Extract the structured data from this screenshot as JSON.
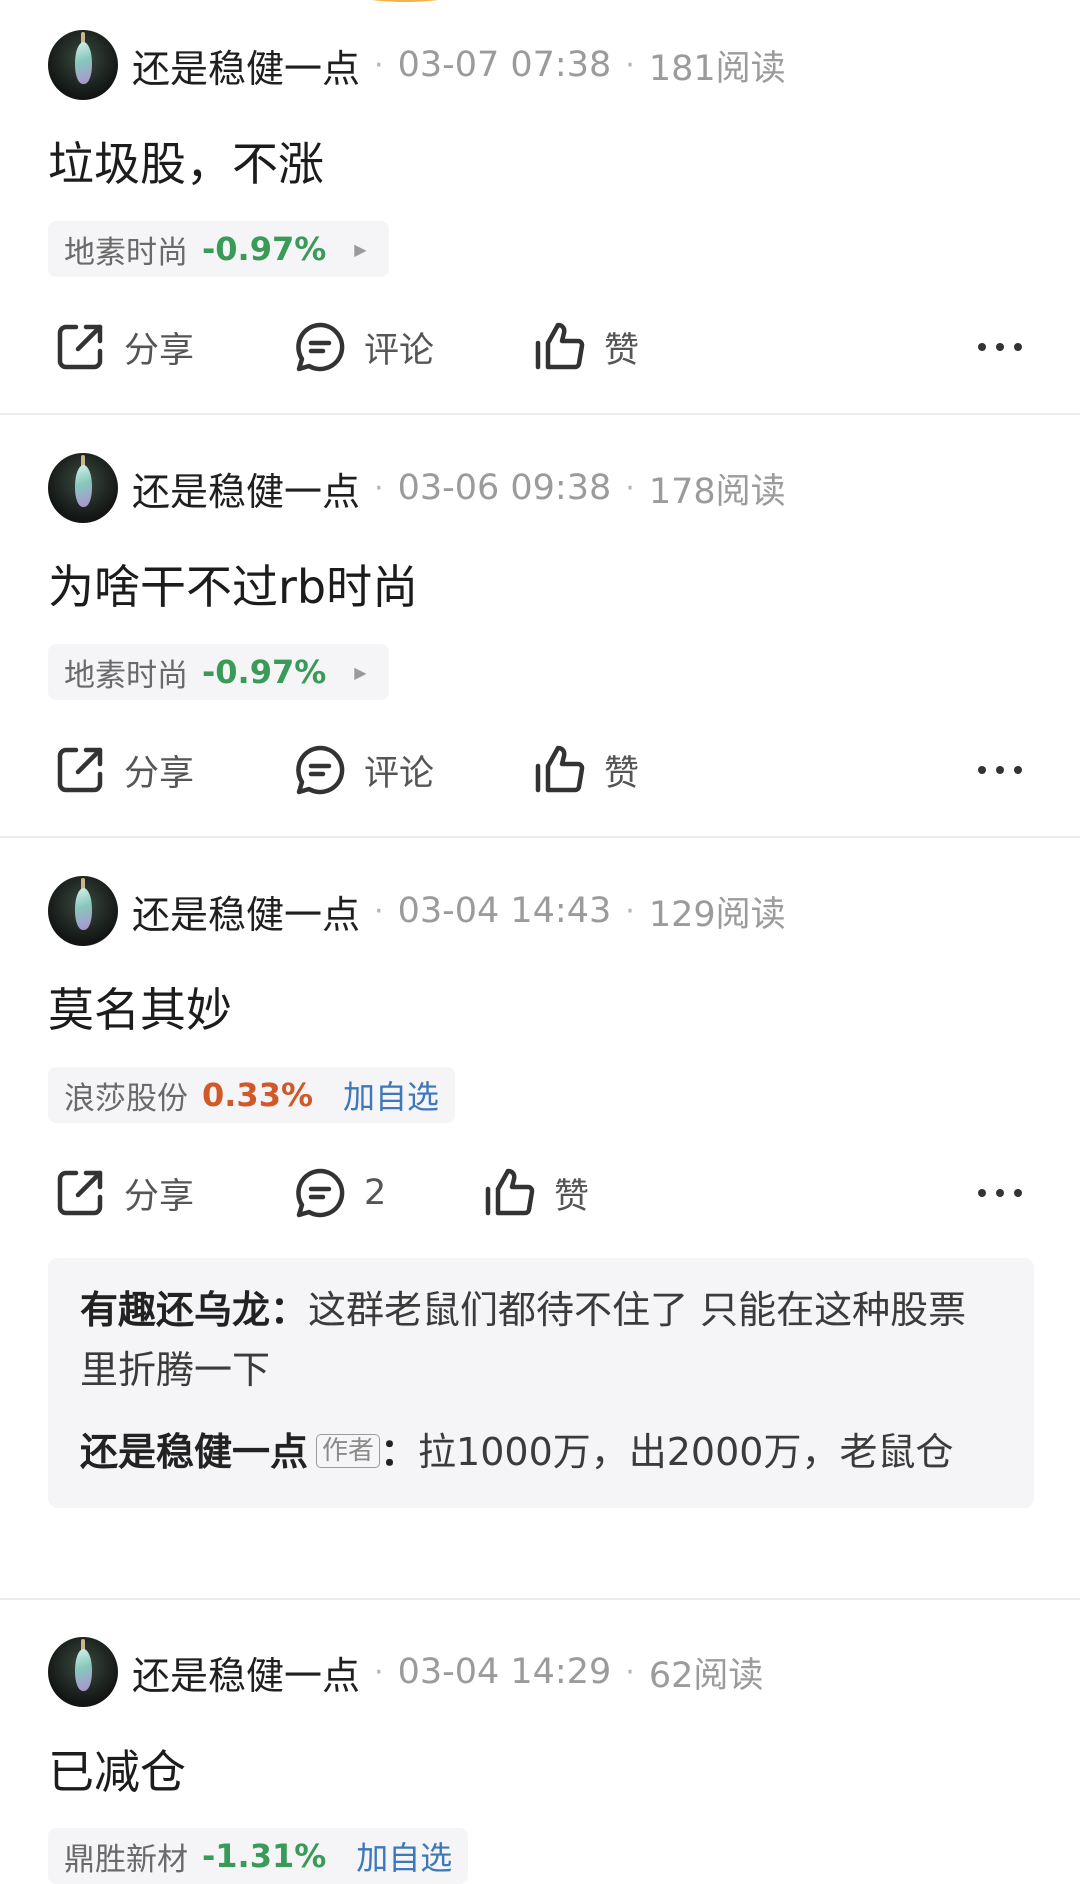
{
  "colors": {
    "down": "#3a9a57",
    "up": "#d0592a",
    "add_link": "#3d78b8"
  },
  "actions": {
    "share": "分享",
    "comment": "评论",
    "like": "赞"
  },
  "posts": [
    {
      "username": "还是稳健一点",
      "time": "03-07 07:38",
      "reads": "181阅读",
      "content": "垃圾股，不涨",
      "stock": {
        "name": "地素时尚",
        "change": "-0.97%",
        "direction": "down"
      }
    },
    {
      "username": "还是稳健一点",
      "time": "03-06 09:38",
      "reads": "178阅读",
      "content": "为啥干不过rb时尚",
      "stock": {
        "name": "地素时尚",
        "change": "-0.97%",
        "direction": "down"
      }
    },
    {
      "username": "还是稳健一点",
      "time": "03-04 14:43",
      "reads": "129阅读",
      "content": "莫名其妙",
      "stock": {
        "name": "浪莎股份",
        "change": "0.33%",
        "direction": "up",
        "add_label": "加自选"
      },
      "comment_count": "2",
      "comments": [
        {
          "author": "有趣还乌龙",
          "text": "这群老鼠们都待不住了 只能在这种股票里折腾一下"
        },
        {
          "author": "还是稳健一点",
          "badge": "作者",
          "text": "拉1000万，出2000万，老鼠仓"
        }
      ]
    },
    {
      "username": "还是稳健一点",
      "time": "03-04 14:29",
      "reads": "62阅读",
      "content": "已减仓",
      "stock": {
        "name": "鼎胜新材",
        "change": "-1.31%",
        "direction": "down",
        "add_label": "加自选"
      }
    }
  ]
}
